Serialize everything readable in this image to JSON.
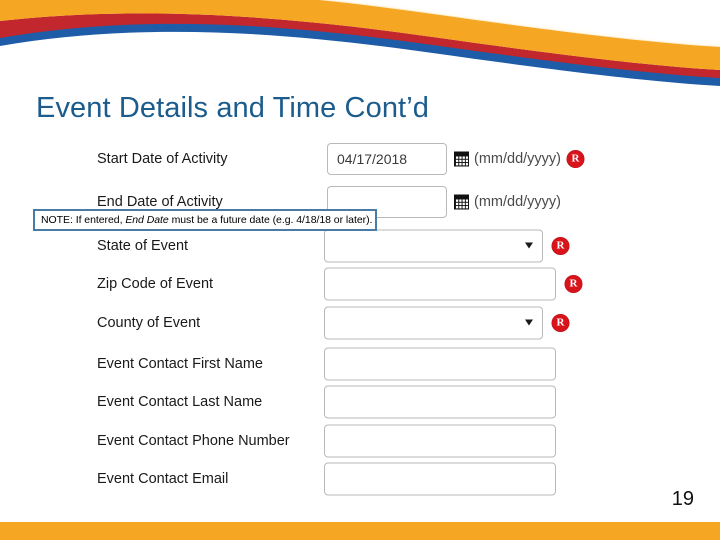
{
  "slide": {
    "title": "Event Details and Time Cont’d",
    "page_number": "19",
    "title_color": "#1B5C8C",
    "accent_orange": "#F5A623",
    "accent_red": "#C1272D",
    "accent_blue": "#1F5CA8",
    "required_badge_color": "#D8131A"
  },
  "note": {
    "prefix": "NOTE: If entered, ",
    "emphasis": "End Date",
    "suffix": " must be a future date (e.g. 4/18/18 or later)."
  },
  "form": {
    "fields": [
      {
        "label": "Start Date of Activity",
        "control": "text",
        "value": "04/17/2018",
        "has_calendar": true,
        "hint": "(mm/dd/yyyy)",
        "required": true
      },
      {
        "label": "End Date of Activity",
        "control": "text",
        "value": "",
        "has_calendar": true,
        "hint": "(mm/dd/yyyy)",
        "required": false
      },
      {
        "label": "State of Event",
        "control": "select",
        "value": "",
        "has_calendar": false,
        "hint": "",
        "required": true
      },
      {
        "label": "Zip Code of Event",
        "control": "text",
        "value": "",
        "has_calendar": false,
        "hint": "",
        "required": true
      },
      {
        "label": "County of Event",
        "control": "select",
        "value": "",
        "has_calendar": false,
        "hint": "",
        "required": true
      },
      {
        "label": "Event Contact First Name",
        "control": "text",
        "value": "",
        "has_calendar": false,
        "hint": "",
        "required": false
      },
      {
        "label": "Event Contact Last Name",
        "control": "text",
        "value": "",
        "has_calendar": false,
        "hint": "",
        "required": false
      },
      {
        "label": "Event Contact Phone Number",
        "control": "text",
        "value": "",
        "has_calendar": false,
        "hint": "",
        "required": false
      },
      {
        "label": "Event Contact Email",
        "control": "text",
        "value": "",
        "has_calendar": false,
        "hint": "",
        "required": false
      }
    ]
  },
  "icons": {
    "calendar": "calendar-icon",
    "dropdown": "chevron-down-icon",
    "required": "required-badge-icon"
  }
}
